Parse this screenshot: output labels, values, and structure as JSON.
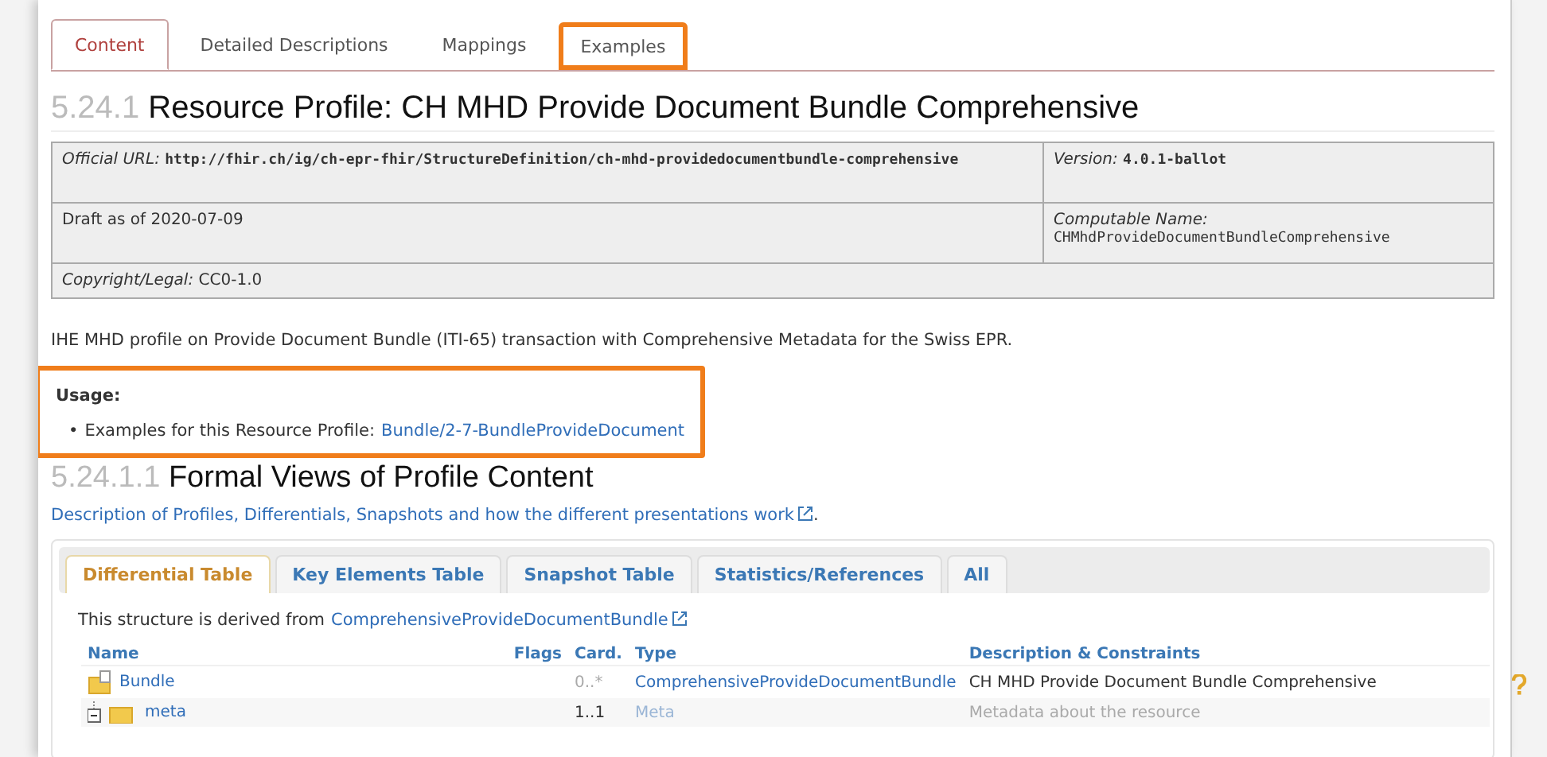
{
  "tabs": [
    {
      "label": "Content",
      "selected": true,
      "highlighted": false
    },
    {
      "label": "Detailed Descriptions",
      "selected": false,
      "highlighted": false
    },
    {
      "label": "Mappings",
      "selected": false,
      "highlighted": false
    },
    {
      "label": "Examples",
      "selected": false,
      "highlighted": true
    }
  ],
  "heading": {
    "number": "5.24.1",
    "title": "Resource Profile: CH MHD Provide Document Bundle Comprehensive"
  },
  "meta_box": {
    "official_url": {
      "label": "Official URL:",
      "value": "http://fhir.ch/ig/ch-epr-fhir/StructureDefinition/ch-mhd-providedocumentbundle-comprehensive"
    },
    "version": {
      "label": "Version:",
      "value": "4.0.1-ballot"
    },
    "status": "Draft as of 2020-07-09",
    "computable_name": {
      "label": "Computable Name:",
      "value": "CHMhdProvideDocumentBundleComprehensive"
    },
    "copyright": {
      "label": "Copyright/Legal:",
      "value": "CC0-1.0"
    }
  },
  "description": "IHE MHD profile on Provide Document Bundle (ITI-65) transaction with Comprehensive Metadata for the Swiss EPR.",
  "usage": {
    "title": "Usage:",
    "highlighted": true,
    "items": [
      {
        "bullet": "•",
        "text": "Examples for this Resource Profile:",
        "link": "Bundle/2-7-BundleProvideDocument"
      }
    ]
  },
  "formal_views": {
    "number": "5.24.1.1",
    "title": "Formal Views of Profile Content",
    "link": "Description of Profiles, Differentials, Snapshots and how the different presentations work",
    "suffix": "."
  },
  "view_tabs": [
    {
      "label": "Differential Table",
      "selected": true
    },
    {
      "label": "Key Elements Table",
      "selected": false
    },
    {
      "label": "Snapshot Table",
      "selected": false
    },
    {
      "label": "Statistics/References",
      "selected": false
    },
    {
      "label": "All",
      "selected": false
    }
  ],
  "derived": {
    "text": "This structure is derived from",
    "link": "ComprehensiveProvideDocumentBundle"
  },
  "table": {
    "columns": [
      "Name",
      "Flags",
      "Card.",
      "Type",
      "Description & Constraints"
    ],
    "rows": [
      {
        "kind": "root",
        "name": "Bundle",
        "card": "0..*",
        "type": "ComprehensiveProvideDocumentBundle",
        "description": "CH MHD Provide Document Bundle Comprehensive",
        "inherited": false
      },
      {
        "kind": "child",
        "name": "meta",
        "card": "1..1",
        "type": "Meta",
        "description": "Metadata about the resource",
        "inherited": true
      }
    ]
  }
}
